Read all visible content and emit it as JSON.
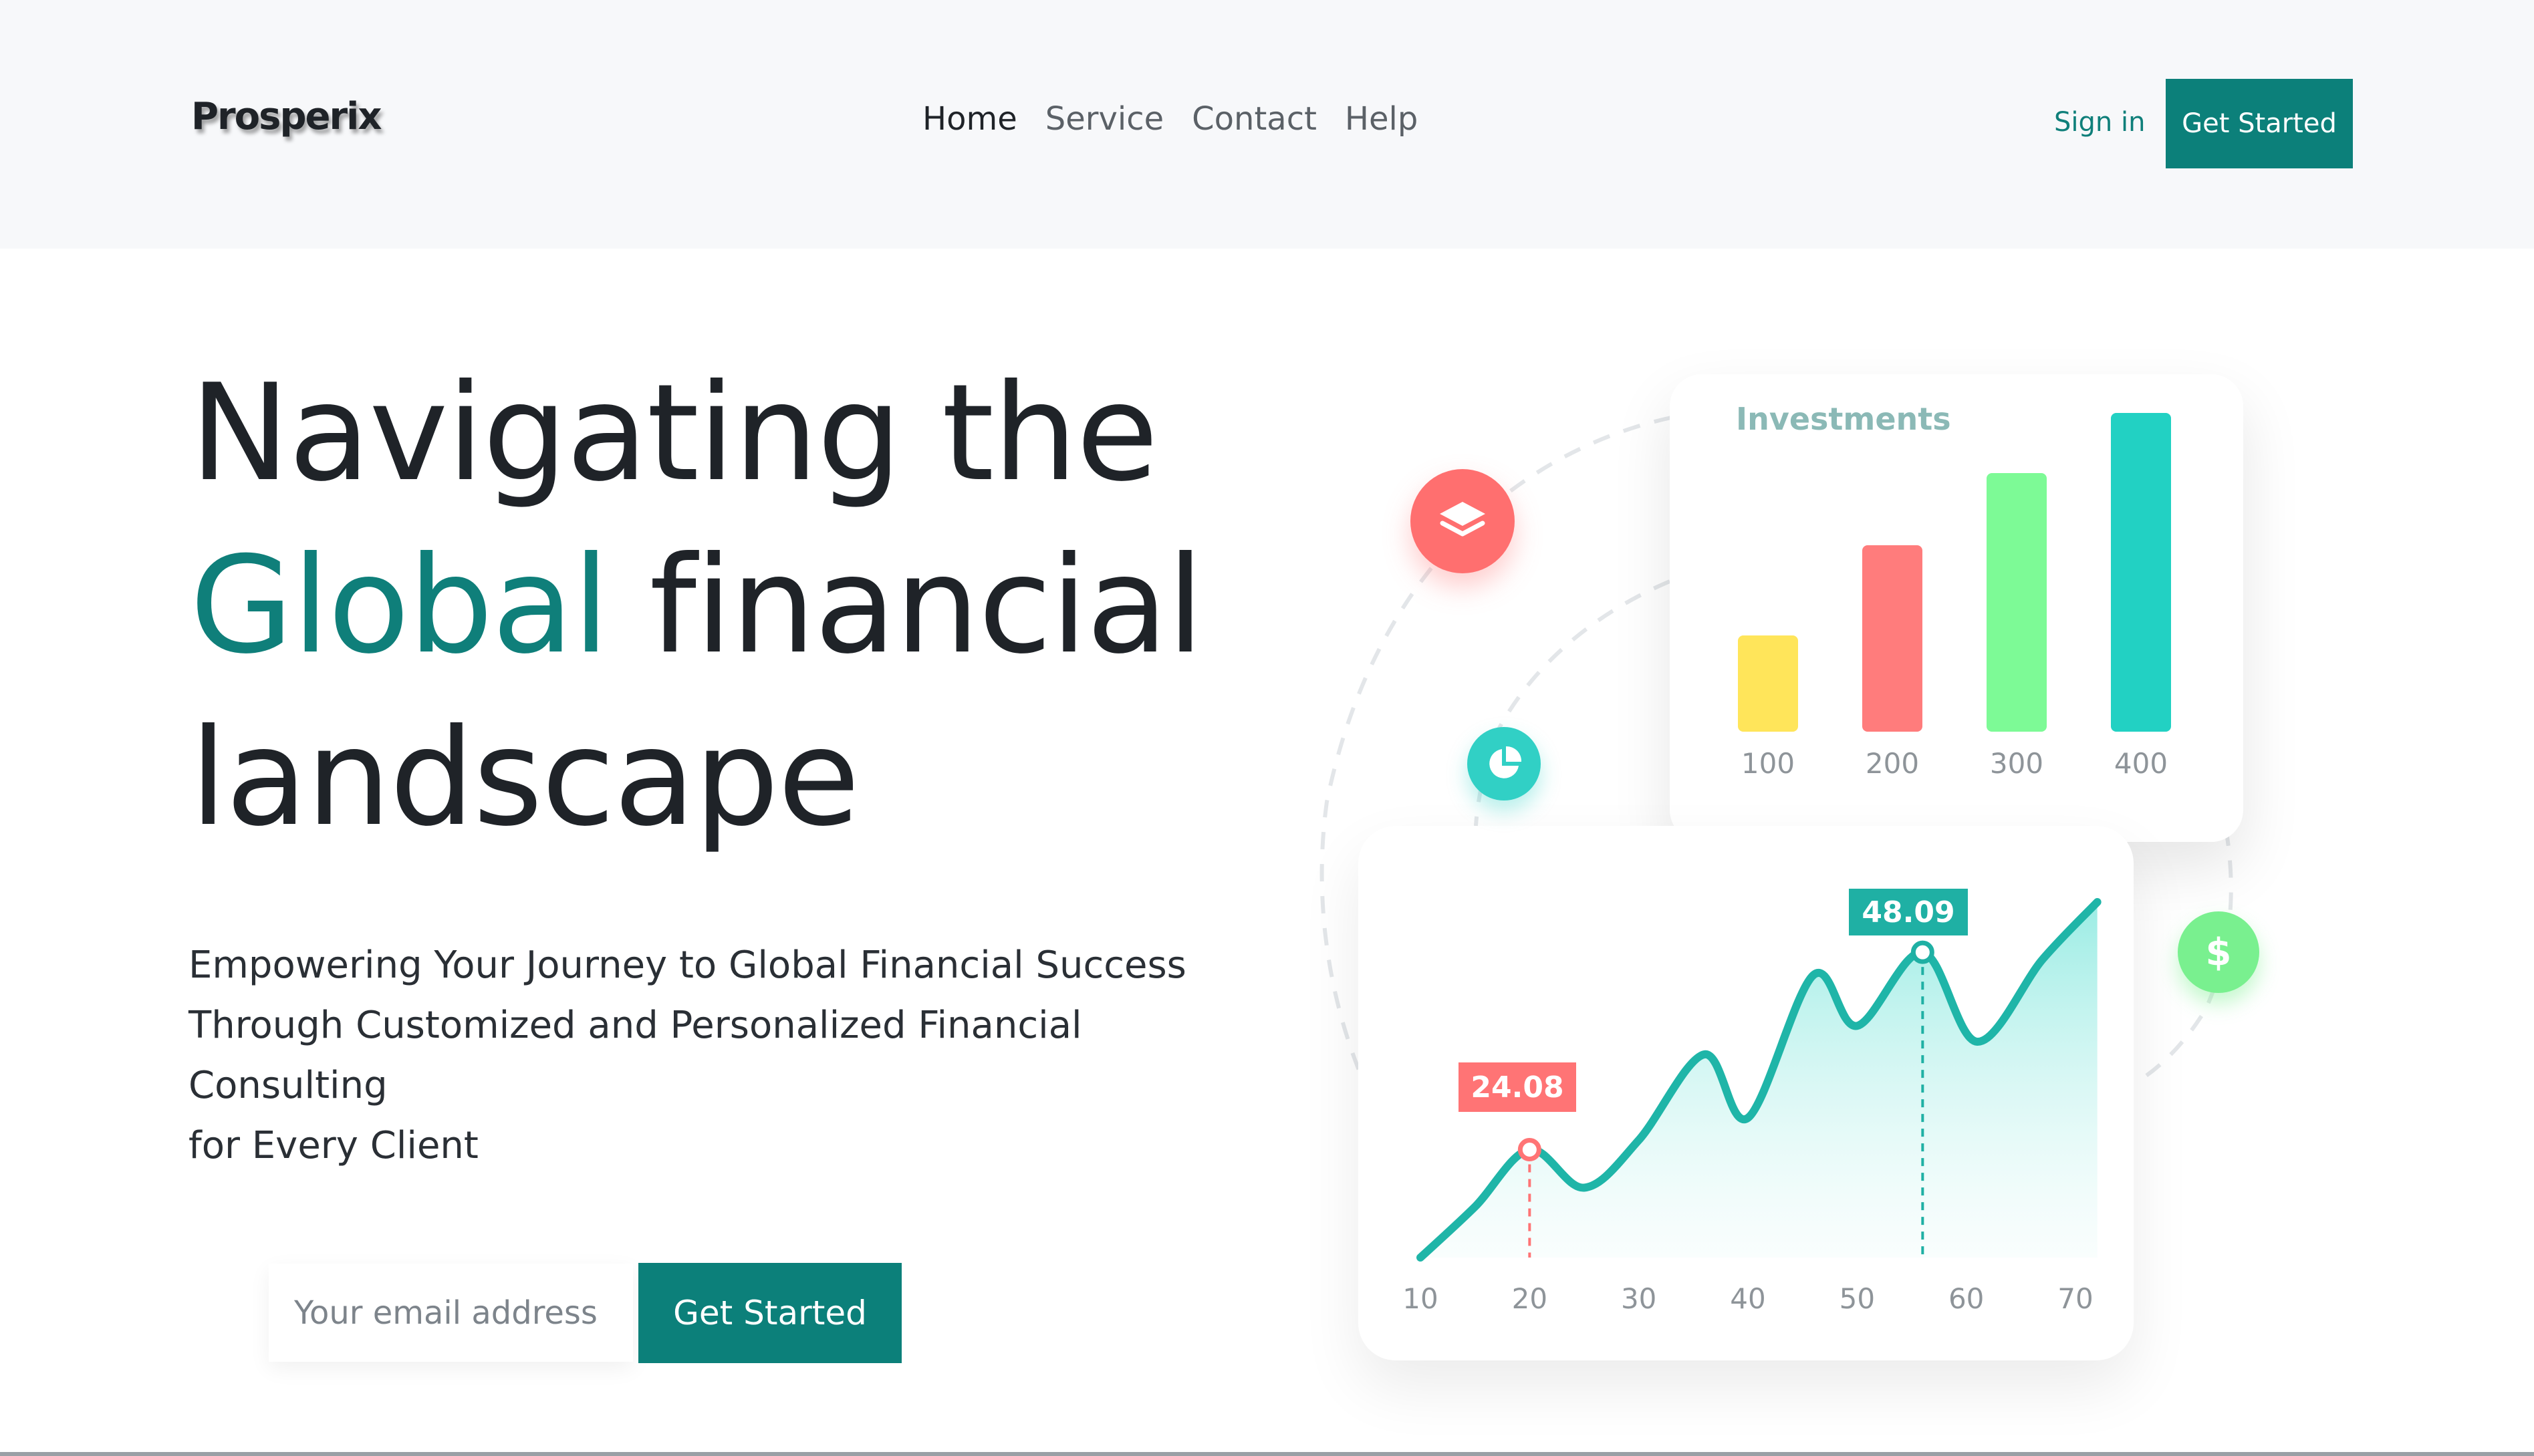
{
  "nav": {
    "brand": "Prosperix",
    "links": [
      {
        "label": "Home",
        "active": true
      },
      {
        "label": "Service",
        "active": false
      },
      {
        "label": "Contact",
        "active": false
      },
      {
        "label": "Help",
        "active": false
      }
    ],
    "signin_label": "Sign in",
    "cta_label": "Get Started"
  },
  "hero": {
    "title_line1": "Navigating the",
    "title_accent": "Global",
    "title_line2_rest": " financial",
    "title_line3": "landscape",
    "subtitle_line1": "Empowering Your Journey to Global Financial Success",
    "subtitle_line2": "Through Customized and Personalized Financial Consulting",
    "subtitle_line3": "for Every Client",
    "email_placeholder": "Your email address",
    "cta_label": "Get Started"
  },
  "colors": {
    "accent": "#0c807a",
    "bar_colors": [
      "#ffe55a",
      "#ff7c7c",
      "#7dfa96",
      "#22d1c3"
    ],
    "pin_red": "#ff6f6f",
    "pin_teal": "#31d0c5",
    "pin_green": "#79f08f"
  },
  "icons": {
    "pin_1": "layers-icon",
    "pin_2": "pie-chart-icon",
    "pin_3": "dollar-icon"
  },
  "pins": {
    "dollar_symbol": "$"
  },
  "chart_data": [
    {
      "type": "bar",
      "title": "Investments",
      "categories": [
        "100",
        "200",
        "300",
        "400"
      ],
      "values": [
        1.6,
        3.1,
        4.3,
        5.3
      ],
      "ylim": [
        0,
        5.5
      ]
    },
    {
      "type": "area",
      "title": "",
      "x": [
        10,
        15,
        20,
        25,
        30,
        36,
        40,
        46,
        50,
        56,
        61,
        67,
        72
      ],
      "y": [
        0.0,
        8.0,
        17.0,
        11.0,
        18.5,
        32.0,
        22.0,
        44.5,
        36.5,
        48.09,
        34.0,
        47.0,
        56.0
      ],
      "xticks": [
        "10",
        "20",
        "30",
        "40",
        "50",
        "60",
        "70"
      ],
      "annotations": [
        {
          "x": 20,
          "y": 24.08,
          "label": "24.08"
        },
        {
          "x": 56,
          "y": 48.09,
          "label": "48.09"
        }
      ],
      "ylim": [
        0,
        60
      ],
      "xlim": [
        10,
        72
      ]
    }
  ]
}
